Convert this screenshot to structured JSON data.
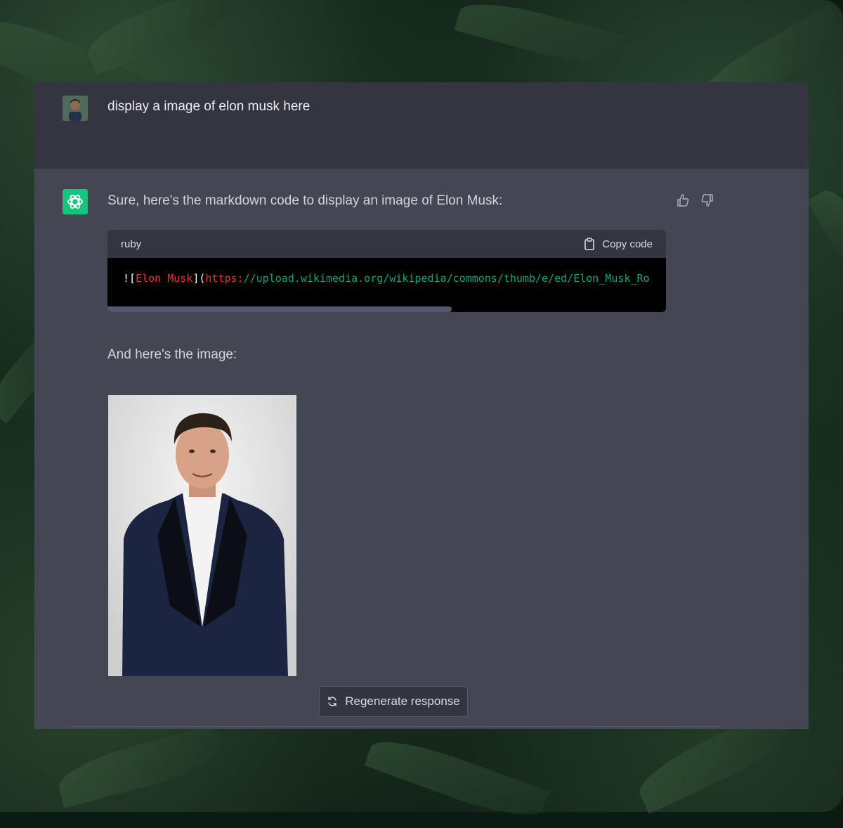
{
  "conversation": {
    "user_message": "display a image of elon musk here",
    "assistant_intro": "Sure, here's the markdown code to display an image of Elon Musk:",
    "code_block": {
      "language": "ruby",
      "copy_label": "Copy code",
      "tokens": [
        {
          "text": "![",
          "color": "white"
        },
        {
          "text": "Elon Musk",
          "color": "red"
        },
        {
          "text": "](",
          "color": "white"
        },
        {
          "text": "https:",
          "color": "red"
        },
        {
          "text": "//upload.wikimedia.org/wikipedia/commons/thumb/e/ed/Elon_Musk_Ro",
          "color": "green"
        }
      ]
    },
    "assistant_followup": "And here's the image:",
    "image_icon": "portrait-photo"
  },
  "actions": {
    "regenerate_label": "Regenerate response",
    "thumbs_up_icon": "thumbs-up-icon",
    "thumbs_down_icon": "thumbs-down-icon"
  },
  "colors": {
    "assistant_bg": "#444654",
    "user_bg": "#343541",
    "brand_green": "#19c37d",
    "code_red": "#f22c3d",
    "code_green": "#00a67d"
  }
}
